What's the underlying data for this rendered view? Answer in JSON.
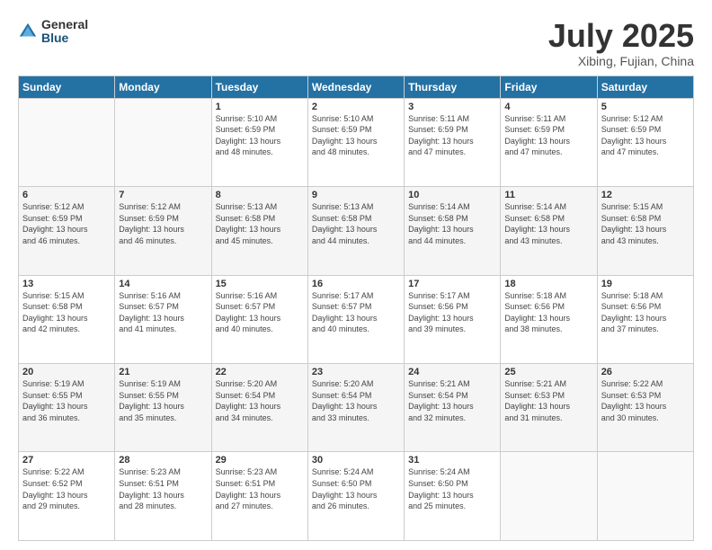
{
  "logo": {
    "general": "General",
    "blue": "Blue"
  },
  "header": {
    "title": "July 2025",
    "subtitle": "Xibing, Fujian, China"
  },
  "weekdays": [
    "Sunday",
    "Monday",
    "Tuesday",
    "Wednesday",
    "Thursday",
    "Friday",
    "Saturday"
  ],
  "weeks": [
    [
      {
        "day": "",
        "info": ""
      },
      {
        "day": "",
        "info": ""
      },
      {
        "day": "1",
        "info": "Sunrise: 5:10 AM\nSunset: 6:59 PM\nDaylight: 13 hours\nand 48 minutes."
      },
      {
        "day": "2",
        "info": "Sunrise: 5:10 AM\nSunset: 6:59 PM\nDaylight: 13 hours\nand 48 minutes."
      },
      {
        "day": "3",
        "info": "Sunrise: 5:11 AM\nSunset: 6:59 PM\nDaylight: 13 hours\nand 47 minutes."
      },
      {
        "day": "4",
        "info": "Sunrise: 5:11 AM\nSunset: 6:59 PM\nDaylight: 13 hours\nand 47 minutes."
      },
      {
        "day": "5",
        "info": "Sunrise: 5:12 AM\nSunset: 6:59 PM\nDaylight: 13 hours\nand 47 minutes."
      }
    ],
    [
      {
        "day": "6",
        "info": "Sunrise: 5:12 AM\nSunset: 6:59 PM\nDaylight: 13 hours\nand 46 minutes."
      },
      {
        "day": "7",
        "info": "Sunrise: 5:12 AM\nSunset: 6:59 PM\nDaylight: 13 hours\nand 46 minutes."
      },
      {
        "day": "8",
        "info": "Sunrise: 5:13 AM\nSunset: 6:58 PM\nDaylight: 13 hours\nand 45 minutes."
      },
      {
        "day": "9",
        "info": "Sunrise: 5:13 AM\nSunset: 6:58 PM\nDaylight: 13 hours\nand 44 minutes."
      },
      {
        "day": "10",
        "info": "Sunrise: 5:14 AM\nSunset: 6:58 PM\nDaylight: 13 hours\nand 44 minutes."
      },
      {
        "day": "11",
        "info": "Sunrise: 5:14 AM\nSunset: 6:58 PM\nDaylight: 13 hours\nand 43 minutes."
      },
      {
        "day": "12",
        "info": "Sunrise: 5:15 AM\nSunset: 6:58 PM\nDaylight: 13 hours\nand 43 minutes."
      }
    ],
    [
      {
        "day": "13",
        "info": "Sunrise: 5:15 AM\nSunset: 6:58 PM\nDaylight: 13 hours\nand 42 minutes."
      },
      {
        "day": "14",
        "info": "Sunrise: 5:16 AM\nSunset: 6:57 PM\nDaylight: 13 hours\nand 41 minutes."
      },
      {
        "day": "15",
        "info": "Sunrise: 5:16 AM\nSunset: 6:57 PM\nDaylight: 13 hours\nand 40 minutes."
      },
      {
        "day": "16",
        "info": "Sunrise: 5:17 AM\nSunset: 6:57 PM\nDaylight: 13 hours\nand 40 minutes."
      },
      {
        "day": "17",
        "info": "Sunrise: 5:17 AM\nSunset: 6:56 PM\nDaylight: 13 hours\nand 39 minutes."
      },
      {
        "day": "18",
        "info": "Sunrise: 5:18 AM\nSunset: 6:56 PM\nDaylight: 13 hours\nand 38 minutes."
      },
      {
        "day": "19",
        "info": "Sunrise: 5:18 AM\nSunset: 6:56 PM\nDaylight: 13 hours\nand 37 minutes."
      }
    ],
    [
      {
        "day": "20",
        "info": "Sunrise: 5:19 AM\nSunset: 6:55 PM\nDaylight: 13 hours\nand 36 minutes."
      },
      {
        "day": "21",
        "info": "Sunrise: 5:19 AM\nSunset: 6:55 PM\nDaylight: 13 hours\nand 35 minutes."
      },
      {
        "day": "22",
        "info": "Sunrise: 5:20 AM\nSunset: 6:54 PM\nDaylight: 13 hours\nand 34 minutes."
      },
      {
        "day": "23",
        "info": "Sunrise: 5:20 AM\nSunset: 6:54 PM\nDaylight: 13 hours\nand 33 minutes."
      },
      {
        "day": "24",
        "info": "Sunrise: 5:21 AM\nSunset: 6:54 PM\nDaylight: 13 hours\nand 32 minutes."
      },
      {
        "day": "25",
        "info": "Sunrise: 5:21 AM\nSunset: 6:53 PM\nDaylight: 13 hours\nand 31 minutes."
      },
      {
        "day": "26",
        "info": "Sunrise: 5:22 AM\nSunset: 6:53 PM\nDaylight: 13 hours\nand 30 minutes."
      }
    ],
    [
      {
        "day": "27",
        "info": "Sunrise: 5:22 AM\nSunset: 6:52 PM\nDaylight: 13 hours\nand 29 minutes."
      },
      {
        "day": "28",
        "info": "Sunrise: 5:23 AM\nSunset: 6:51 PM\nDaylight: 13 hours\nand 28 minutes."
      },
      {
        "day": "29",
        "info": "Sunrise: 5:23 AM\nSunset: 6:51 PM\nDaylight: 13 hours\nand 27 minutes."
      },
      {
        "day": "30",
        "info": "Sunrise: 5:24 AM\nSunset: 6:50 PM\nDaylight: 13 hours\nand 26 minutes."
      },
      {
        "day": "31",
        "info": "Sunrise: 5:24 AM\nSunset: 6:50 PM\nDaylight: 13 hours\nand 25 minutes."
      },
      {
        "day": "",
        "info": ""
      },
      {
        "day": "",
        "info": ""
      }
    ]
  ]
}
